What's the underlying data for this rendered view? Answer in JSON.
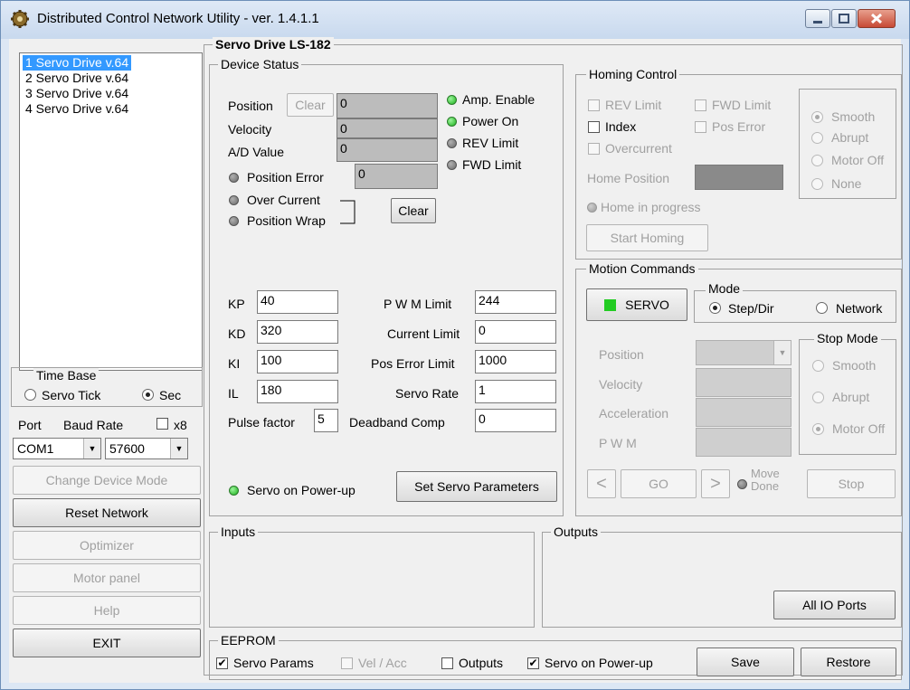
{
  "window": {
    "title": "Distributed Control Network Utility - ver. 1.4.1.1"
  },
  "device_list": {
    "items": [
      "1 Servo Drive v.64",
      "2 Servo Drive v.64",
      "3 Servo Drive v.64",
      "4 Servo Drive v.64"
    ],
    "selected": 0
  },
  "time_base": {
    "title": "Time Base",
    "servo_tick": "Servo Tick",
    "sec": "Sec"
  },
  "port": {
    "label": "Port",
    "baud_label": "Baud Rate",
    "x8": "x8",
    "port_value": "COM1",
    "baud_value": "57600"
  },
  "left_buttons": {
    "change_mode": "Change Device Mode",
    "reset_network": "Reset Network",
    "optimizer": "Optimizer",
    "motor_panel": "Motor panel",
    "help": "Help",
    "exit": "EXIT"
  },
  "main_title": "Servo Drive LS-182",
  "device_status": {
    "title": "Device Status",
    "position_label": "Position",
    "clear_label": "Clear",
    "position_value": "0",
    "velocity_label": "Velocity",
    "velocity_value": "0",
    "ad_label": "A/D Value",
    "ad_value": "0",
    "amp_enable": "Amp. Enable",
    "power_on": "Power On",
    "rev_limit": "REV Limit",
    "fwd_limit": "FWD Limit",
    "position_error": "Position Error",
    "position_error_value": "0",
    "over_current": "Over Current",
    "position_wrap": "Position Wrap",
    "clear_button": "Clear",
    "kp_label": "KP",
    "kp": "40",
    "kd_label": "KD",
    "kd": "320",
    "ki_label": "KI",
    "ki": "100",
    "il_label": "IL",
    "il": "180",
    "pulse_label": "Pulse factor",
    "pulse": "5",
    "pwm_limit_label": "P W M Limit",
    "pwm_limit": "244",
    "current_limit_label": "Current Limit",
    "current_limit": "0",
    "pos_error_limit_label": "Pos Error Limit",
    "pos_error_limit": "1000",
    "servo_rate_label": "Servo  Rate",
    "servo_rate": "1",
    "deadband_label": "Deadband Comp",
    "deadband": "0",
    "servo_power_up": "Servo on Power-up",
    "set_params": "Set Servo Parameters"
  },
  "homing": {
    "title": "Homing Control",
    "rev_limit": "REV Limit",
    "fwd_limit": "FWD Limit",
    "index": "Index",
    "pos_error": "Pos Error",
    "overcurrent": "Overcurrent",
    "home_position": "Home Position",
    "home_in_progress": "Home in progress",
    "start": "Start Homing",
    "smooth": "Smooth",
    "abrupt": "Abrupt",
    "motor_off": "Motor Off",
    "none": "None"
  },
  "motion": {
    "title": "Motion Commands",
    "servo": "SERVO",
    "mode_title": "Mode",
    "step_dir": "Step/Dir",
    "network": "Network",
    "position": "Position",
    "velocity": "Velocity",
    "acceleration": "Acceleration",
    "pwm": "P W M",
    "stop_mode_title": "Stop Mode",
    "smooth": "Smooth",
    "abrupt": "Abrupt",
    "motor_off": "Motor Off",
    "prev": "<",
    "go": "GO",
    "next": ">",
    "move": "Move",
    "done": "Done",
    "stop": "Stop"
  },
  "inputs": {
    "title": "Inputs"
  },
  "outputs": {
    "title": "Outputs",
    "all_io": "All IO Ports"
  },
  "eeprom": {
    "title": "EEPROM",
    "servo_params": "Servo Params",
    "vel_acc": "Vel / Acc",
    "outputs": "Outputs",
    "servo_power_up": "Servo on Power-up",
    "save": "Save",
    "restore": "Restore"
  },
  "colors": {
    "selection": "#3399ff",
    "led_on": "#19b019",
    "servo_indicator": "#22cc22"
  }
}
